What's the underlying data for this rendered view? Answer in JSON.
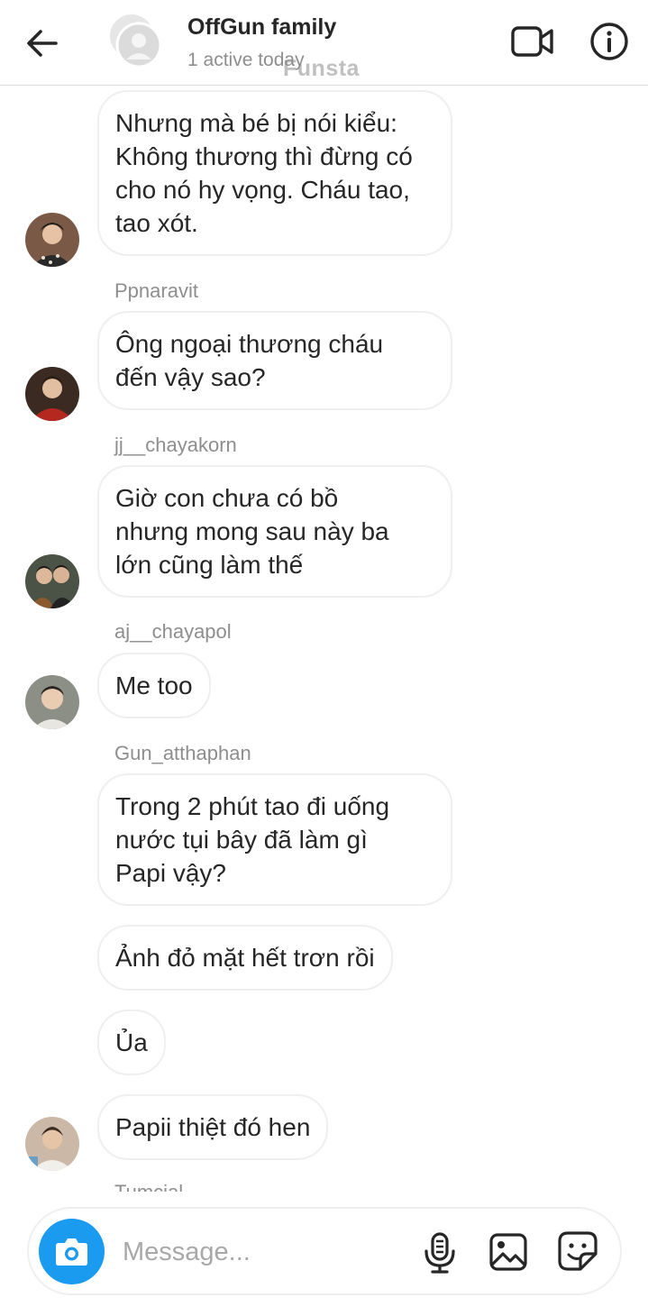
{
  "header": {
    "title": "OffGun family",
    "status": "1 active today",
    "watermark": "Funsta",
    "icons": {
      "back": "arrow-left-icon",
      "video": "video-call-icon",
      "info": "info-icon"
    }
  },
  "messages": [
    {
      "sender": "",
      "text": "Nhưng mà bé bị nói kiểu:\nKhông thương thì đừng có\ncho nó hy vọng. Cháu tao,\ntao xót.",
      "has_avatar": true,
      "avatar_color": "#5a3b2c"
    },
    {
      "sender": "Ppnaravit",
      "text": "Ông ngoại thương cháu\nđến vậy sao?",
      "has_avatar": true,
      "avatar_color": "#7a1f1a"
    },
    {
      "sender": "jj__chayakorn",
      "text": "Giờ con chưa có bồ\nnhưng mong sau này ba\nlớn cũng làm thế",
      "has_avatar": true,
      "avatar_color": "#2d2f2a"
    },
    {
      "sender": "aj__chayapol",
      "text": "Me too",
      "has_avatar": true,
      "avatar_color": "#6b6f66"
    },
    {
      "sender": "Gun_atthaphan",
      "text": "Trong 2 phút tao đi uống\nnước tụi bây đã làm gì\nPapi vậy?",
      "has_avatar": false
    },
    {
      "sender": "",
      "text": "Ảnh đỏ mặt hết trơn rồi",
      "has_avatar": false
    },
    {
      "sender": "",
      "text": "Ủa",
      "has_avatar": false
    },
    {
      "sender": "",
      "text": "Papii thiệt đó hen",
      "has_avatar": true,
      "avatar_color": "#b89a86"
    },
    {
      "sender": "Tumcial",
      "text": "",
      "has_avatar": false
    }
  ],
  "composer": {
    "placeholder": "Message...",
    "icons": {
      "camera": "camera-icon",
      "mic": "microphone-icon",
      "gallery": "image-icon",
      "sticker": "sticker-icon"
    }
  },
  "colors": {
    "accent": "#1a9bf0",
    "bubble_border": "#efefef",
    "secondary_text": "#8e8e8e"
  }
}
